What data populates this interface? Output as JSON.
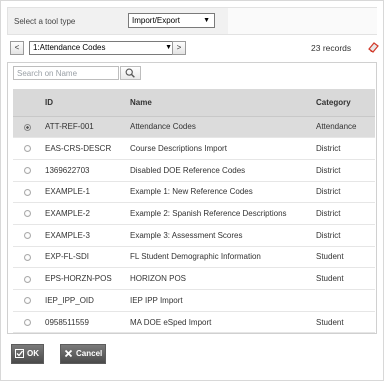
{
  "tool_type": {
    "label": "Select a tool type",
    "selected": "Import/Export",
    "arrow": "▼"
  },
  "navigation": {
    "prev": "<",
    "next": ">",
    "selected": "1:Attendance Codes",
    "arrow": "▼",
    "records": "23 records"
  },
  "search": {
    "placeholder": "Search on Name"
  },
  "table": {
    "headers": {
      "id": "ID",
      "name": "Name",
      "category": "Category"
    },
    "rows": [
      {
        "id": "ATT-REF-001",
        "name": "Attendance Codes",
        "category": "Attendance",
        "selected": true
      },
      {
        "id": "EAS-CRS-DESCR",
        "name": "Course Descriptions Import",
        "category": "District"
      },
      {
        "id": "1369622703",
        "name": "Disabled DOE Reference Codes",
        "category": "District"
      },
      {
        "id": "EXAMPLE-1",
        "name": "Example 1: New Reference Codes",
        "category": "District"
      },
      {
        "id": "EXAMPLE-2",
        "name": "Example 2: Spanish Reference Descriptions",
        "category": "District"
      },
      {
        "id": "EXAMPLE-3",
        "name": "Example 3: Assessment Scores",
        "category": "District"
      },
      {
        "id": "EXP-FL-SDI",
        "name": "FL Student Demographic Information",
        "category": "Student"
      },
      {
        "id": "EPS-HORZN-POS",
        "name": "HORIZON POS",
        "category": "Student"
      },
      {
        "id": "IEP_IPP_OID",
        "name": "IEP IPP Import",
        "category": ""
      },
      {
        "id": "0958511559",
        "name": "MA DOE eSped Import",
        "category": "Student"
      }
    ]
  },
  "buttons": {
    "ok": "OK",
    "cancel": "Cancel"
  },
  "icons": {
    "eraser": "eraser-icon",
    "search": "search-icon",
    "ok": "check-icon",
    "cancel": "close-icon"
  },
  "colors": {
    "header_bg": "#d9d9d9",
    "button_bg": "#5f5f5f",
    "eraser": "#d23a2a"
  }
}
